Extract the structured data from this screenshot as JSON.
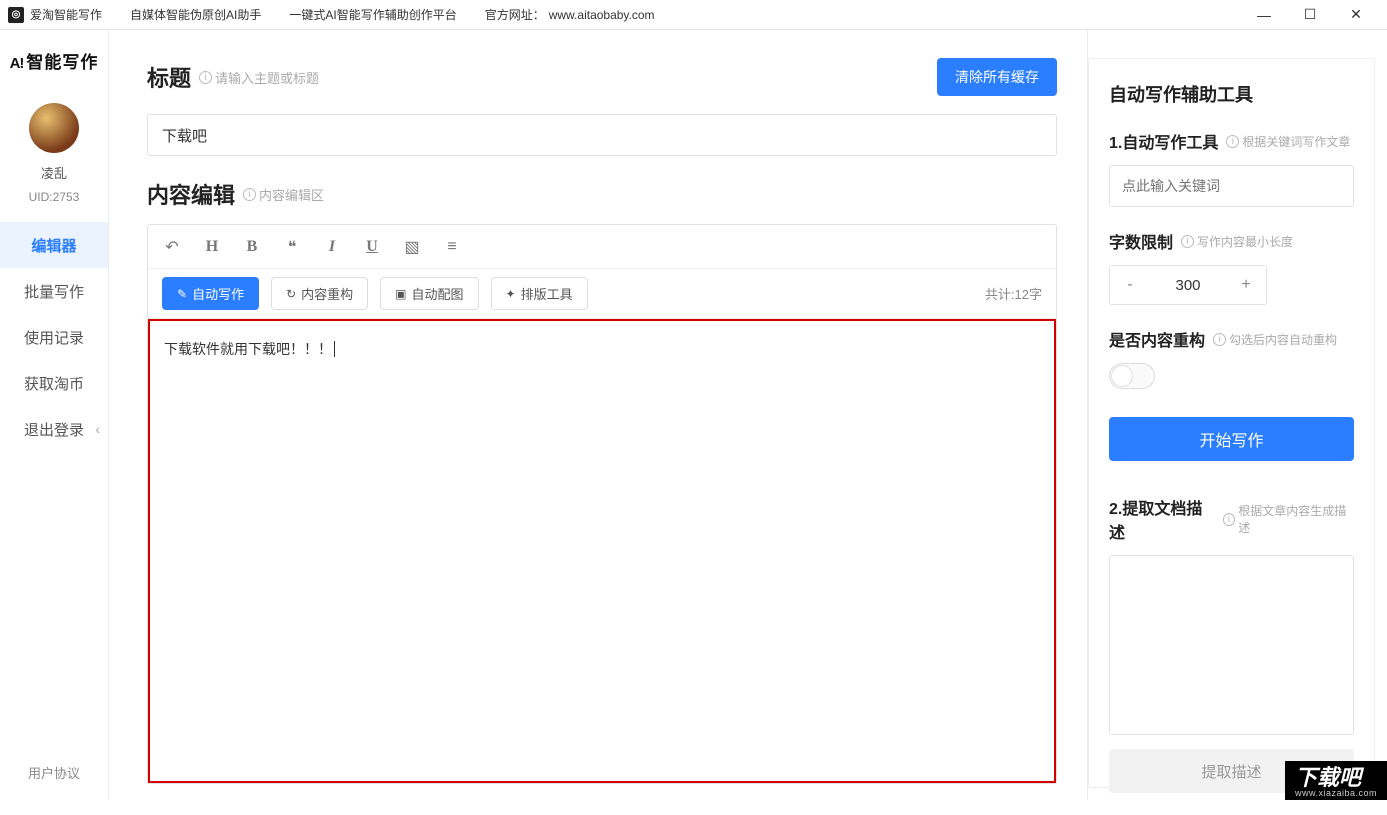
{
  "titlebar": {
    "app_name": "爱淘智能写作",
    "tagline1": "自媒体智能伪原创AI助手",
    "tagline2": "一键式AI智能写作辅助创作平台",
    "site_label": "官方网址：",
    "site_url": "www.aitaobaby.com"
  },
  "sidebar": {
    "brand": "智能写作",
    "username": "凌乱",
    "uid": "UID:2753",
    "items": [
      {
        "label": "编辑器",
        "active": true
      },
      {
        "label": "批量写作",
        "active": false
      },
      {
        "label": "使用记录",
        "active": false
      },
      {
        "label": "获取淘币",
        "active": false
      },
      {
        "label": "退出登录",
        "active": false,
        "chevron": true
      }
    ],
    "footer": "用户协议"
  },
  "main": {
    "title_label": "标题",
    "title_hint": "请输入主题或标题",
    "clear_cache_btn": "清除所有缓存",
    "title_value": "下载吧",
    "content_label": "内容编辑",
    "content_hint": "内容编辑区",
    "toolbar2": {
      "auto_write": "自动写作",
      "reconstruct": "内容重构",
      "auto_image": "自动配图",
      "layout_tool": "排版工具"
    },
    "count_label": "共计:12字",
    "editor_text": "下载软件就用下载吧！！！"
  },
  "right": {
    "panel_title": "自动写作辅助工具",
    "sec1_title": "1.自动写作工具",
    "sec1_hint": "根据关键词写作文章",
    "kw_placeholder": "点此输入关键词",
    "limit_title": "字数限制",
    "limit_hint": "写作内容最小长度",
    "limit_value": "300",
    "recon_title": "是否内容重构",
    "recon_hint": "勾选后内容自动重构",
    "start_btn": "开始写作",
    "sec2_title": "2.提取文档描述",
    "sec2_hint": "根据文章内容生成描述",
    "extract_btn": "提取描述"
  },
  "watermark": {
    "text": "下载吧",
    "sub": "www.xiazaiba.com"
  }
}
